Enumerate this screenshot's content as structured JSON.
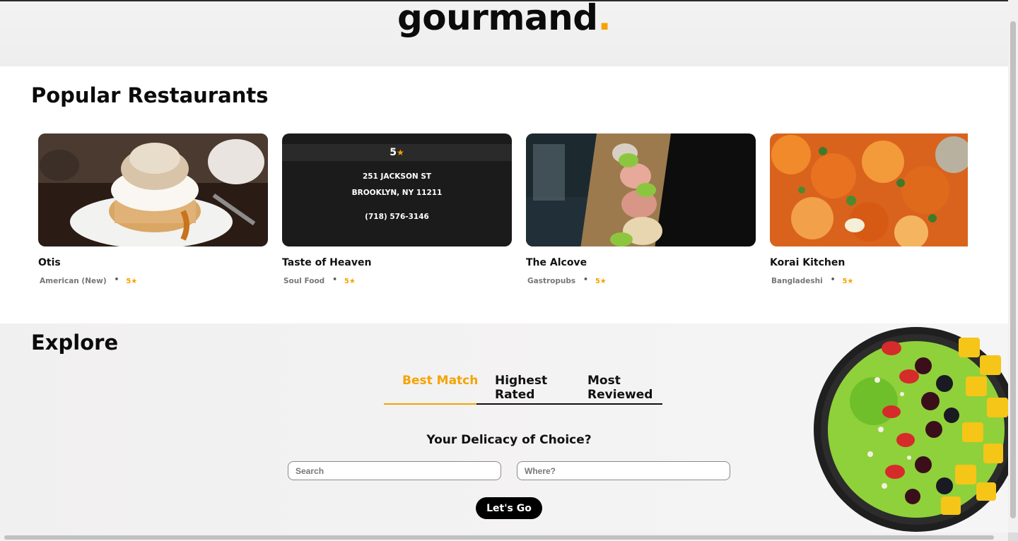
{
  "brand": {
    "name": "gourmand",
    "dot": ".",
    "accent": "#f5a300"
  },
  "popular": {
    "title": "Popular Restaurants",
    "cards": [
      {
        "name": "Otis",
        "category": "American (New)",
        "rating": "5★",
        "image": "souffle-pancake-photo"
      },
      {
        "name": "Taste of Heaven",
        "category": "Soul Food",
        "rating": "5★",
        "hover": {
          "rating": "5",
          "address_line1": "251 JACKSON ST",
          "address_line2": "BROOKLYN, NY 11211",
          "phone": "(718) 576-3146"
        }
      },
      {
        "name": "The Alcove",
        "category": "Gastropubs",
        "rating": "5★",
        "image": "cocktails-photo"
      },
      {
        "name": "Korai Kitchen",
        "category": "Bangladeshi",
        "rating": "5★",
        "image": "fried-vegetables-photo"
      }
    ]
  },
  "explore": {
    "title": "Explore",
    "tabs": [
      "Best Match",
      "Highest Rated",
      "Most Reviewed"
    ],
    "active_tab": "Best Match",
    "question": "Your Delicacy of Choice?",
    "search_placeholder": "Search",
    "where_placeholder": "Where?",
    "button": "Let's Go"
  }
}
